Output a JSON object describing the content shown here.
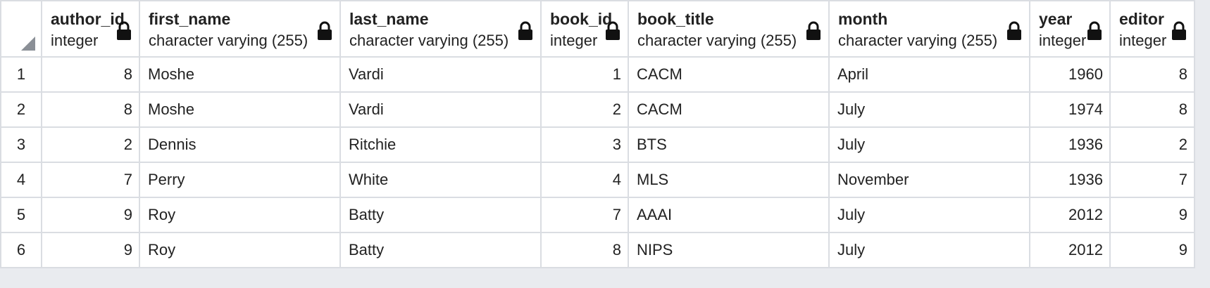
{
  "grid": {
    "columns": [
      {
        "name": "author_id",
        "type": "integer"
      },
      {
        "name": "first_name",
        "type": "character varying (255)"
      },
      {
        "name": "last_name",
        "type": "character varying (255)"
      },
      {
        "name": "book_id",
        "type": "integer"
      },
      {
        "name": "book_title",
        "type": "character varying (255)"
      },
      {
        "name": "month",
        "type": "character varying (255)"
      },
      {
        "name": "year",
        "type": "integer"
      },
      {
        "name": "editor",
        "type": "integer"
      }
    ],
    "rows": [
      {
        "n": "1",
        "cells": [
          "8",
          "Moshe",
          "Vardi",
          "1",
          "CACM",
          "April",
          "1960",
          "8"
        ]
      },
      {
        "n": "2",
        "cells": [
          "8",
          "Moshe",
          "Vardi",
          "2",
          "CACM",
          "July",
          "1974",
          "8"
        ]
      },
      {
        "n": "3",
        "cells": [
          "2",
          "Dennis",
          "Ritchie",
          "3",
          "BTS",
          "July",
          "1936",
          "2"
        ]
      },
      {
        "n": "4",
        "cells": [
          "7",
          "Perry",
          "White",
          "4",
          "MLS",
          "November",
          "1936",
          "7"
        ]
      },
      {
        "n": "5",
        "cells": [
          "9",
          "Roy",
          "Batty",
          "7",
          "AAAI",
          "July",
          "2012",
          "9"
        ]
      },
      {
        "n": "6",
        "cells": [
          "9",
          "Roy",
          "Batty",
          "8",
          "NIPS",
          "July",
          "2012",
          "9"
        ]
      }
    ]
  }
}
